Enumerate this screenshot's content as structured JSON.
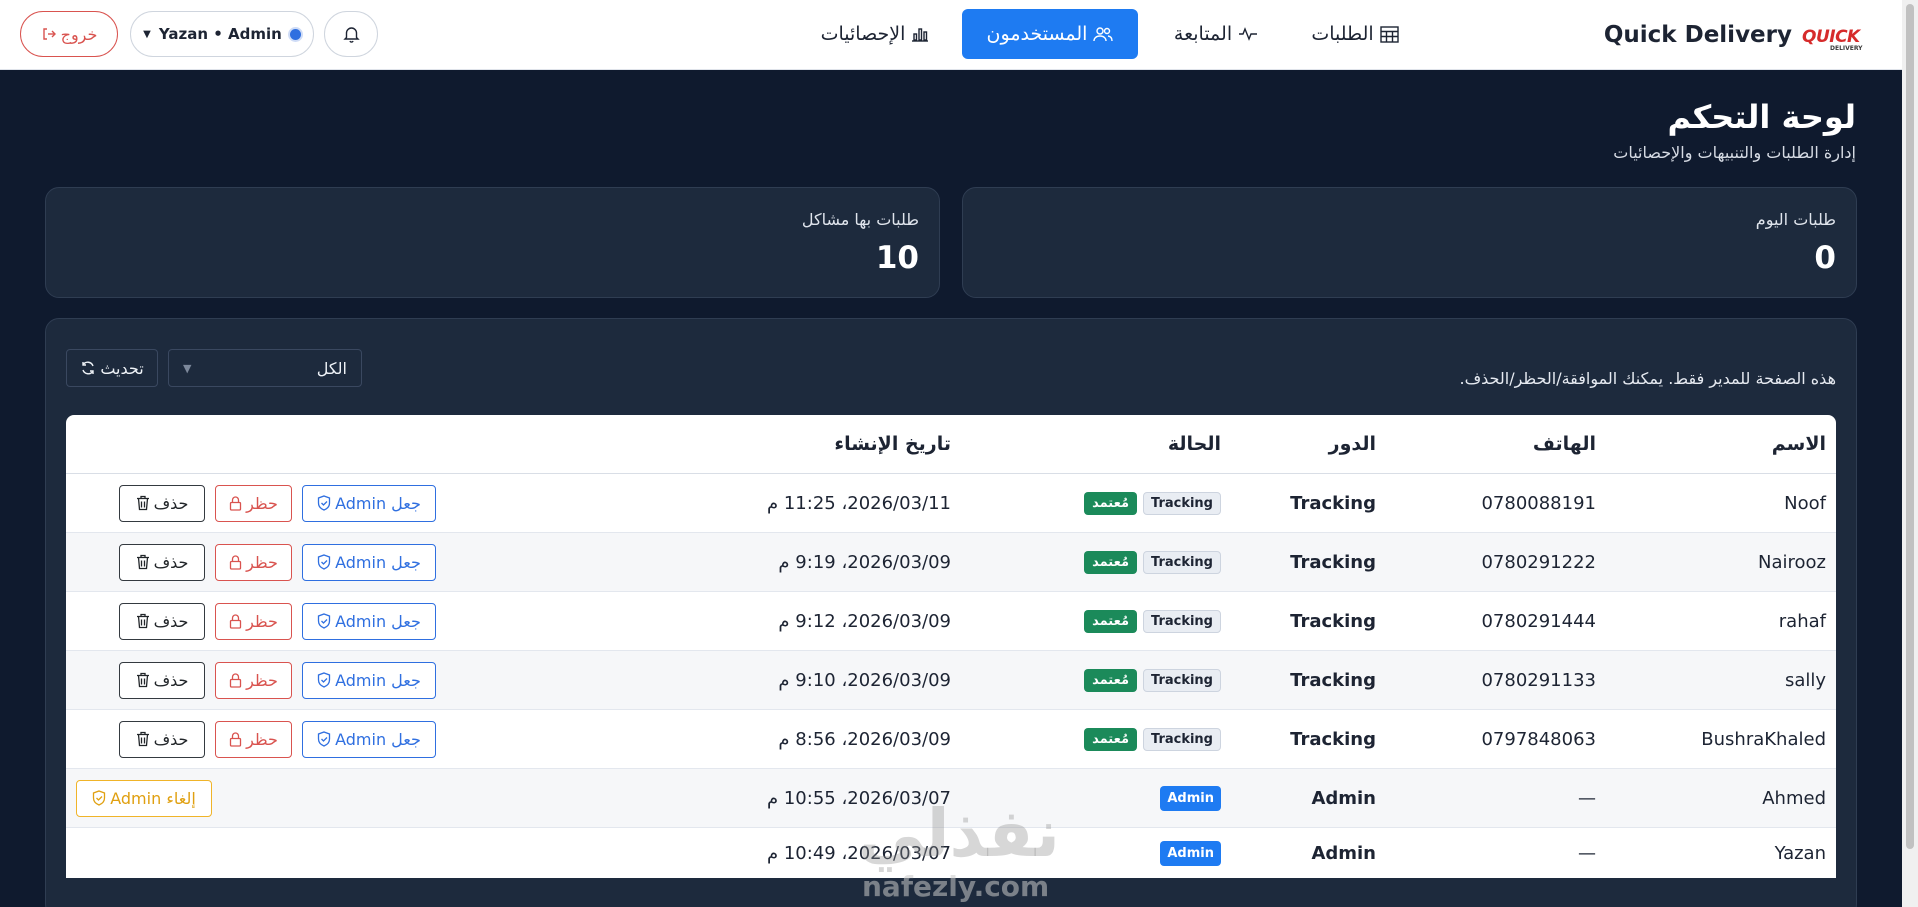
{
  "nav": {
    "brand_name": "Quick Delivery",
    "logo_text": "QUICK",
    "logo_sub": "DELIVERY",
    "logout_label": "خروج",
    "user_label": "Yazan • Admin",
    "items": [
      {
        "label": "الطلبات",
        "icon": "table-icon"
      },
      {
        "label": "المتابعة",
        "icon": "activity-icon"
      },
      {
        "label": "المستخدمون",
        "icon": "users-icon",
        "active": true
      },
      {
        "label": "الإحصائيات",
        "icon": "bar-chart-icon"
      }
    ]
  },
  "header": {
    "title": "لوحة التحكم",
    "subtitle": "إدارة الطلبات والتنبيهات والإحصائيات"
  },
  "stats": [
    {
      "label": "طلبات اليوم",
      "value": "0"
    },
    {
      "label": "طلبات بها مشاكل",
      "value": "10"
    }
  ],
  "panel": {
    "notice": "هذه الصفحة للمدير فقط. يمكنك الموافقة/الحظر/الحذف.",
    "filter_value": "الكل",
    "refresh_label": "تحديث"
  },
  "table": {
    "columns": {
      "name": "الاسم",
      "phone": "الهاتف",
      "role": "الدور",
      "status": "الحالة",
      "created": "تاريخ الإنشاء"
    },
    "actions": {
      "delete": "حذف",
      "ban": "حظر",
      "make_admin": "جعل Admin",
      "revoke_admin": "إلغاء Admin"
    },
    "rows": [
      {
        "name": "Noof",
        "phone": "0780088191",
        "role": "Tracking",
        "role_badge": "Tracking",
        "status": "مُعتمد",
        "created": "2026/03/11، 11:25 م"
      },
      {
        "name": "Nairooz",
        "phone": "0780291222",
        "role": "Tracking",
        "role_badge": "Tracking",
        "status": "مُعتمد",
        "created": "2026/03/09، 9:19 م"
      },
      {
        "name": "rahaf",
        "phone": "0780291444",
        "role": "Tracking",
        "role_badge": "Tracking",
        "status": "مُعتمد",
        "created": "2026/03/09، 9:12 م"
      },
      {
        "name": "sally",
        "phone": "0780291133",
        "role": "Tracking",
        "role_badge": "Tracking",
        "status": "مُعتمد",
        "created": "2026/03/09، 9:10 م"
      },
      {
        "name": "BushraKhaled",
        "phone": "0797848063",
        "role": "Tracking",
        "role_badge": "Tracking",
        "status": "مُعتمد",
        "created": "2026/03/09، 8:56 م"
      },
      {
        "name": "Ahmed",
        "phone": "—",
        "role": "Admin",
        "role_badge": "Admin",
        "status": "",
        "created": "2026/03/07، 10:55 م"
      },
      {
        "name": "Yazan",
        "phone": "—",
        "role": "Admin",
        "role_badge": "Admin",
        "status": "",
        "created": "2026/03/07، 10:49 م"
      }
    ]
  },
  "watermark": {
    "arabic": "نفذلي",
    "latin": "nafezly.com"
  },
  "colors": {
    "page_bg": "#0f1a2e",
    "card_bg": "#1d2a3d",
    "primary": "#1e7bf2",
    "danger": "#d9534f",
    "success": "#1b8a5a",
    "warning": "#f0b429"
  }
}
